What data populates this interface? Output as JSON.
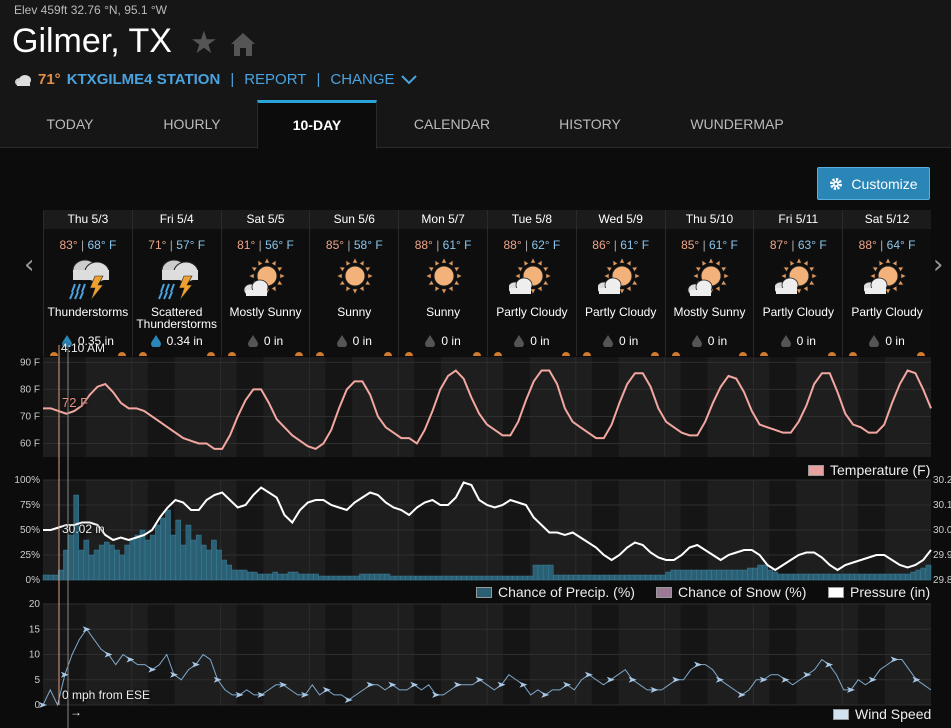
{
  "location": {
    "coords": "Elev 459ft 32.76 °N, 95.1 °W",
    "city": "Gilmer, TX",
    "current_temp": "71°",
    "station": "KTXGILME4 STATION",
    "report_label": "REPORT",
    "change_label": "CHANGE",
    "separator": "|"
  },
  "tabs": [
    "TODAY",
    "HOURLY",
    "10-DAY",
    "CALENDAR",
    "HISTORY",
    "WUNDERMAP"
  ],
  "active_tab": "10-DAY",
  "customize_label": "Customize",
  "nav": {
    "prev": "‹",
    "next": "›"
  },
  "days": [
    {
      "name": "Thu 5/3",
      "hi": "83°",
      "lo": "68° F",
      "cond": "Thunderstorms",
      "precip": "0.35 in",
      "icon": "thunderstorm-icon"
    },
    {
      "name": "Fri 5/4",
      "hi": "71°",
      "lo": "57° F",
      "cond": "Scattered Thunderstorms",
      "precip": "0.34 in",
      "icon": "thunderstorm-icon"
    },
    {
      "name": "Sat 5/5",
      "hi": "81°",
      "lo": "56° F",
      "cond": "Mostly Sunny",
      "precip": "0 in",
      "icon": "mostly-sunny-icon"
    },
    {
      "name": "Sun 5/6",
      "hi": "85°",
      "lo": "58° F",
      "cond": "Sunny",
      "precip": "0 in",
      "icon": "sunny-icon"
    },
    {
      "name": "Mon 5/7",
      "hi": "88°",
      "lo": "61° F",
      "cond": "Sunny",
      "precip": "0 in",
      "icon": "sunny-icon"
    },
    {
      "name": "Tue 5/8",
      "hi": "88°",
      "lo": "62° F",
      "cond": "Partly Cloudy",
      "precip": "0 in",
      "icon": "partly-cloudy-icon"
    },
    {
      "name": "Wed 5/9",
      "hi": "86°",
      "lo": "61° F",
      "cond": "Partly Cloudy",
      "precip": "0 in",
      "icon": "partly-cloudy-icon"
    },
    {
      "name": "Thu 5/10",
      "hi": "85°",
      "lo": "61° F",
      "cond": "Mostly Sunny",
      "precip": "0 in",
      "icon": "mostly-sunny-icon"
    },
    {
      "name": "Fri 5/11",
      "hi": "87°",
      "lo": "63° F",
      "cond": "Partly Cloudy",
      "precip": "0 in",
      "icon": "partly-cloudy-icon"
    },
    {
      "name": "Sat 5/12",
      "hi": "88°",
      "lo": "64° F",
      "cond": "Partly Cloudy",
      "precip": "0 in",
      "icon": "partly-cloudy-icon"
    }
  ],
  "cursor": {
    "time": "4:10 AM",
    "temp": "72 F",
    "pressure": "30.02 in",
    "wind": "0 mph from ESE",
    "wind_arrow": "→"
  },
  "colors": {
    "temperature": "#f2a7a0",
    "precip": "#2b5f74",
    "pressure": "#ffffff",
    "wind": "#a9c8e6",
    "accent": "#2aa3d9"
  },
  "chart_data": [
    {
      "type": "line",
      "ylim": [
        55,
        92
      ],
      "yticks": [
        "90 F",
        "80 F",
        "70 F",
        "60 F"
      ],
      "series": [
        {
          "name": "Temperature (F)",
          "values": [
            73,
            73,
            72,
            71,
            72,
            74,
            78,
            81,
            82,
            79,
            75,
            73,
            73,
            72,
            70,
            68,
            66,
            64,
            62,
            61,
            60,
            60,
            58,
            58,
            63,
            70,
            76,
            80,
            80,
            75,
            69,
            66,
            63,
            61,
            59,
            58,
            60,
            65,
            73,
            80,
            83,
            83,
            78,
            70,
            66,
            64,
            62,
            62,
            60,
            65,
            72,
            80,
            85,
            87,
            84,
            77,
            71,
            67,
            65,
            63,
            63,
            68,
            76,
            83,
            87,
            87,
            82,
            73,
            68,
            66,
            64,
            62,
            62,
            67,
            75,
            82,
            86,
            86,
            81,
            73,
            68,
            66,
            64,
            63,
            63,
            68,
            75,
            81,
            85,
            84,
            79,
            72,
            67,
            66,
            65,
            64,
            64,
            68,
            74,
            82,
            86,
            86,
            79,
            71,
            67,
            66,
            64,
            64,
            67,
            75,
            82,
            87,
            86,
            80,
            73
          ]
        }
      ]
    },
    {
      "type": "bar",
      "ylim": [
        0,
        100
      ],
      "yticks": [
        "100%",
        "75%",
        "50%",
        "25%",
        "0%"
      ],
      "y2ticks": [
        "30.2",
        "30.1",
        "30.0",
        "29.9",
        "29.8"
      ],
      "series": [
        {
          "name": "Chance of Precip. (%)",
          "values": [
            5,
            5,
            5,
            10,
            30,
            45,
            85,
            30,
            40,
            25,
            30,
            35,
            38,
            35,
            30,
            25,
            35,
            40,
            45,
            50,
            40,
            45,
            55,
            62,
            70,
            45,
            60,
            35,
            55,
            40,
            45,
            35,
            30,
            40,
            30,
            20,
            15,
            10,
            10,
            10,
            8,
            8,
            6,
            6,
            6,
            8,
            6,
            6,
            8,
            8,
            6,
            6,
            6,
            6,
            4,
            4,
            4,
            4,
            4,
            4,
            4,
            4,
            6,
            6,
            6,
            6,
            6,
            6,
            4,
            4,
            4,
            4,
            4,
            4,
            4,
            4,
            4,
            4,
            4,
            4,
            4,
            4,
            4,
            4,
            4,
            4,
            4,
            4,
            4,
            4,
            4,
            4,
            4,
            4,
            4,
            4,
            15,
            15,
            15,
            15,
            5,
            5,
            5,
            5,
            5,
            5,
            5,
            5,
            5,
            5,
            5,
            5,
            5,
            5,
            5,
            5,
            5,
            5,
            5,
            5,
            5,
            5,
            8,
            10,
            10,
            10,
            10,
            10,
            10,
            10,
            10,
            10,
            10,
            10,
            10,
            10,
            10,
            10,
            12,
            12,
            15,
            15,
            10,
            8,
            6,
            6,
            6,
            6,
            6,
            6,
            6,
            6,
            6,
            6,
            6,
            6,
            6,
            6,
            6,
            6,
            6,
            6,
            6,
            6,
            6,
            6,
            6,
            6,
            6,
            6,
            8,
            10,
            12,
            15
          ]
        },
        {
          "name": "Chance of Snow (%)",
          "values": []
        },
        {
          "name": "Pressure (in)",
          "values": [
            30.0,
            30.0,
            30.01,
            30.02,
            30.02,
            30.03,
            30.03,
            30.02,
            29.98,
            29.96,
            29.97,
            29.96,
            29.97,
            29.98,
            30.0,
            30.05,
            30.09,
            30.12,
            30.11,
            30.08,
            30.08,
            30.12,
            30.14,
            30.15,
            30.12,
            30.09,
            30.1,
            30.14,
            30.17,
            30.15,
            30.13,
            30.06,
            30.03,
            30.08,
            30.11,
            30.12,
            30.12,
            30.1,
            30.09,
            30.08,
            30.11,
            30.13,
            30.15,
            30.14,
            30.11,
            30.09,
            30.08,
            30.06,
            30.09,
            30.11,
            30.12,
            30.1,
            30.1,
            30.13,
            30.19,
            30.18,
            30.12,
            30.1,
            30.09,
            30.1,
            30.12,
            30.11,
            30.1,
            30.05,
            30.02,
            29.99,
            29.99,
            29.98,
            29.99,
            29.97,
            29.95,
            29.93,
            29.9,
            29.88,
            29.9,
            29.93,
            29.95,
            29.94,
            29.91,
            29.89,
            29.88,
            29.88,
            29.9,
            29.93,
            29.94,
            29.92,
            29.9,
            29.88,
            29.9,
            29.91,
            29.92,
            29.92,
            29.9,
            29.86,
            29.84,
            29.86,
            29.88,
            29.9,
            29.91,
            29.91,
            29.89,
            29.86,
            29.84,
            29.86,
            29.87,
            29.88,
            29.89,
            29.9,
            29.9,
            29.88,
            29.86,
            29.85,
            29.86,
            29.88,
            29.92
          ]
        }
      ]
    },
    {
      "type": "line",
      "ylim": [
        0,
        20
      ],
      "yticks": [
        "20",
        "15",
        "10",
        "5",
        "0"
      ],
      "series": [
        {
          "name": "Wind Speed",
          "values": [
            0,
            3,
            0,
            6,
            10,
            13,
            15,
            13,
            11,
            10,
            8,
            10,
            9,
            8,
            8,
            7,
            8,
            10,
            6,
            5,
            7,
            8,
            10,
            9,
            5,
            3,
            2,
            2,
            3,
            2,
            2,
            3,
            4,
            4,
            3,
            2,
            2,
            4,
            2,
            3,
            2,
            2,
            1,
            2,
            3,
            4,
            4,
            3,
            4,
            3,
            3,
            4,
            3,
            4,
            2,
            2,
            3,
            4,
            4,
            4,
            5,
            4,
            3,
            4,
            6,
            5,
            4,
            2,
            3,
            2,
            3,
            3,
            4,
            3,
            5,
            6,
            5,
            4,
            5,
            6,
            7,
            5,
            4,
            3,
            3,
            3,
            4,
            5,
            5,
            7,
            8,
            8,
            7,
            5,
            4,
            3,
            2,
            3,
            5,
            5,
            6,
            6,
            5,
            4,
            5,
            6,
            7,
            9,
            8,
            6,
            3,
            3,
            5,
            4,
            5,
            7,
            8,
            9,
            9,
            7,
            5,
            4,
            3
          ]
        }
      ]
    }
  ]
}
